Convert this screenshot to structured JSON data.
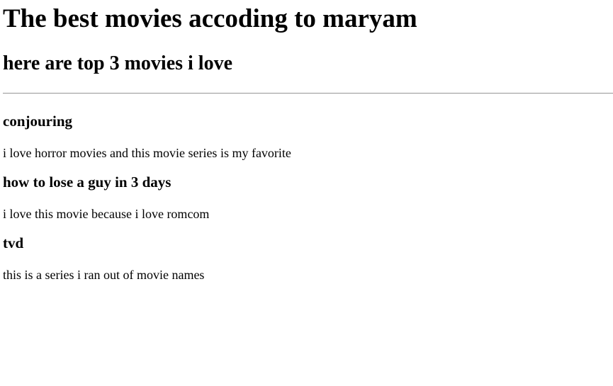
{
  "page": {
    "title": "The best movies accoding to maryam",
    "subtitle": "here are top 3 movies i love"
  },
  "movies": [
    {
      "name": "conjouring",
      "description": "i love horror movies and this movie series is my favorite"
    },
    {
      "name": "how to lose a guy in 3 days",
      "description": "i love this movie because i love romcom"
    },
    {
      "name": "tvd",
      "description": "this is a series i ran out of movie names"
    }
  ]
}
